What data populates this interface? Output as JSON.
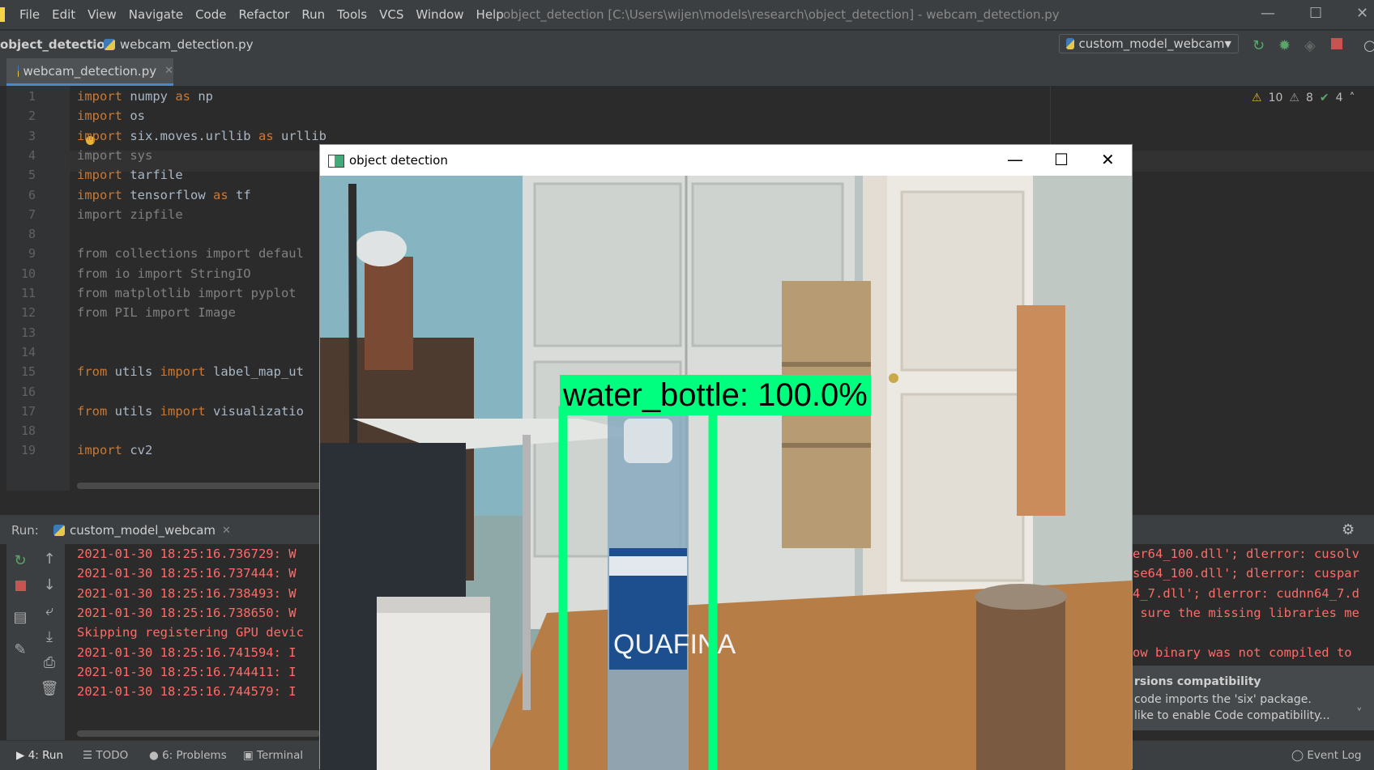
{
  "menubar": {
    "items": [
      "File",
      "Edit",
      "View",
      "Navigate",
      "Code",
      "Refactor",
      "Run",
      "Tools",
      "VCS",
      "Window",
      "Help"
    ],
    "window_title": "object_detection [C:\\Users\\wijen\\models\\research\\object_detection] - webcam_detection.py"
  },
  "navbar": {
    "project": "object_detection",
    "file": "webcam_detection.py",
    "run_config": "custom_model_webcam"
  },
  "editor": {
    "tab": "webcam_detection.py",
    "inspections": {
      "warnings": "10",
      "weak_warnings": "8",
      "ok": "4"
    },
    "lines": [
      {
        "n": "1",
        "kw": "import",
        "rest": " numpy ",
        "kw2": "as",
        "rest2": " np",
        "dim": false
      },
      {
        "n": "2",
        "kw": "import",
        "rest": " os",
        "kw2": "",
        "rest2": "",
        "dim": false
      },
      {
        "n": "3",
        "kw": "import",
        "rest": " six.moves.urllib ",
        "kw2": "as",
        "rest2": " urllib",
        "dim": false
      },
      {
        "n": "4",
        "kw": "import",
        "rest": " sys",
        "kw2": "",
        "rest2": "",
        "dim": true
      },
      {
        "n": "5",
        "kw": "import",
        "rest": " tarfile",
        "kw2": "",
        "rest2": "",
        "dim": false
      },
      {
        "n": "6",
        "kw": "import",
        "rest": " tensorflow ",
        "kw2": "as",
        "rest2": " tf",
        "dim": false
      },
      {
        "n": "7",
        "kw": "import",
        "rest": " zipfile",
        "kw2": "",
        "rest2": "",
        "dim": true
      },
      {
        "n": "8",
        "kw": "",
        "rest": "",
        "kw2": "",
        "rest2": "",
        "dim": false
      },
      {
        "n": "9",
        "kw": "from",
        "rest": " collections import defaul",
        "kw2": "",
        "rest2": "",
        "dim": true
      },
      {
        "n": "10",
        "kw": "from",
        "rest": " io import StringIO",
        "kw2": "",
        "rest2": "",
        "dim": true
      },
      {
        "n": "11",
        "kw": "from",
        "rest": " matplotlib import pyplot",
        "kw2": "",
        "rest2": "",
        "dim": true
      },
      {
        "n": "12",
        "kw": "from",
        "rest": " PIL import Image",
        "kw2": "",
        "rest2": "",
        "dim": true
      },
      {
        "n": "13",
        "kw": "",
        "rest": "",
        "kw2": "",
        "rest2": "",
        "dim": false
      },
      {
        "n": "14",
        "kw": "",
        "rest": "",
        "kw2": "",
        "rest2": "",
        "dim": false
      },
      {
        "n": "15",
        "kw": "from",
        "rest": " utils ",
        "kw2": "import",
        "rest2": " label_map_ut",
        "dim": false
      },
      {
        "n": "16",
        "kw": "",
        "rest": "",
        "kw2": "",
        "rest2": "",
        "dim": false
      },
      {
        "n": "17",
        "kw": "from",
        "rest": " utils ",
        "kw2": "import",
        "rest2": " visualizatio",
        "dim": false
      },
      {
        "n": "18",
        "kw": "",
        "rest": "",
        "kw2": "",
        "rest2": "",
        "dim": false
      },
      {
        "n": "19",
        "kw": "import",
        "rest": " cv2",
        "kw2": "",
        "rest2": "",
        "dim": false
      }
    ]
  },
  "run": {
    "label": "Run:",
    "tab": "custom_model_webcam",
    "log_left": [
      "2021-01-30 18:25:16.736729: W",
      "2021-01-30 18:25:16.737444: W",
      "2021-01-30 18:25:16.738493: W",
      "2021-01-30 18:25:16.738650: W",
      "Skipping registering GPU devic",
      "2021-01-30 18:25:16.741594: I",
      "2021-01-30 18:25:16.744411: I",
      "2021-01-30 18:25:16.744579: I"
    ],
    "log_right": [
      "er64_100.dll'; dlerror: cusolv",
      "se64_100.dll'; dlerror: cuspar",
      "4_7.dll'; dlerror: cudnn64_7.d",
      " sure the missing libraries me",
      "",
      "ow binary was not compiled to"
    ]
  },
  "notification": {
    "title": "rsions compatibility",
    "line1": "code imports the 'six' package.",
    "line2": "like to enable Code compatibility..."
  },
  "statusbar": {
    "run": "4: Run",
    "todo": "TODO",
    "problems": "6: Problems",
    "terminal": "Terminal",
    "event_log": "Event Log"
  },
  "cv_window": {
    "title": "object detection",
    "detection_label": "water_bottle: 100.0%",
    "bottle_brand": "QUAFINA",
    "box_color": "#00ff7f"
  }
}
